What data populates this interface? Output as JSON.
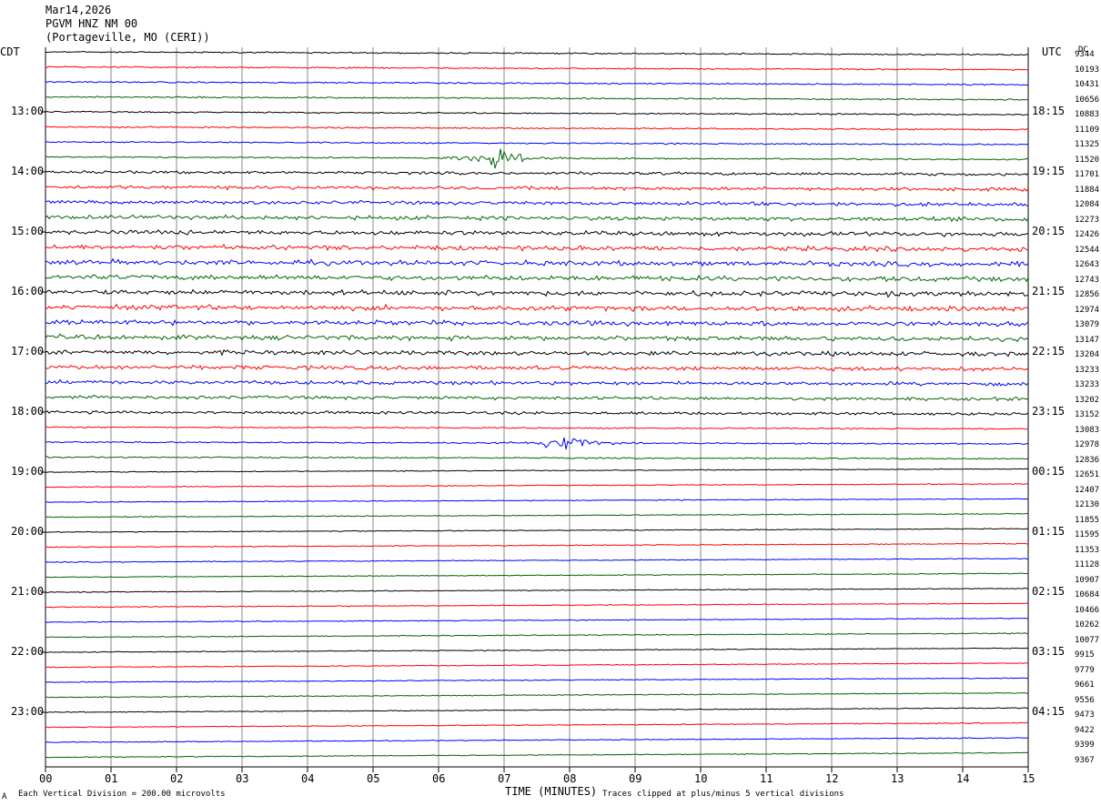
{
  "header": {
    "date": "Mar14,2026",
    "station": "PGVM HNZ NM 00",
    "location": "(Portageville, MO (CERI))"
  },
  "left_axis_label": "CDT",
  "right_axis_label": "UTC",
  "dc_label": "DC",
  "chart_data": {
    "type": "line",
    "xlabel": "TIME (MINUTES)",
    "xlim": [
      0,
      15
    ],
    "x_ticks": [
      "00",
      "01",
      "02",
      "03",
      "04",
      "05",
      "06",
      "07",
      "08",
      "09",
      "10",
      "11",
      "12",
      "13",
      "14",
      "15"
    ],
    "trace_count": 48,
    "trace_colors": [
      "#000000",
      "#ff0000",
      "#0000ff",
      "#006400"
    ],
    "left_hour_labels": [
      "13:00",
      "14:00",
      "15:00",
      "16:00",
      "17:00",
      "18:00",
      "19:00",
      "20:00",
      "21:00",
      "22:00",
      "23:00"
    ],
    "right_hour_labels": [
      "18:15",
      "19:15",
      "20:15",
      "21:15",
      "22:15",
      "23:15",
      "00:15",
      "01:15",
      "02:15",
      "03:15",
      "04:15"
    ],
    "dc_offsets": [
      "9344",
      "10193",
      "10431",
      "10656",
      "10883",
      "11109",
      "11325",
      "11520",
      "11701",
      "11884",
      "12084",
      "12273",
      "12426",
      "12544",
      "12643",
      "12743",
      "12856",
      "12974",
      "13079",
      "13147",
      "13204",
      "13233",
      "13233",
      "13202",
      "13152",
      "13083",
      "12978",
      "12836",
      "12651",
      "12407",
      "12130",
      "11855",
      "11595",
      "11353",
      "11128",
      "10907",
      "10684",
      "10466",
      "10262",
      "10077",
      "9915",
      "9779",
      "9661",
      "9556",
      "9473",
      "9422",
      "9399",
      "9367"
    ],
    "events": [
      {
        "trace": 7,
        "minute": 6.9,
        "label": ""
      },
      {
        "trace": 26,
        "minute": 7.9,
        "label": ""
      }
    ]
  },
  "footer": {
    "scale_note": "Each Vertical Division =  200.00 microvolts",
    "clip_note": "Traces clipped at plus/minus 5 vertical divisions",
    "corner_mark": "A"
  }
}
